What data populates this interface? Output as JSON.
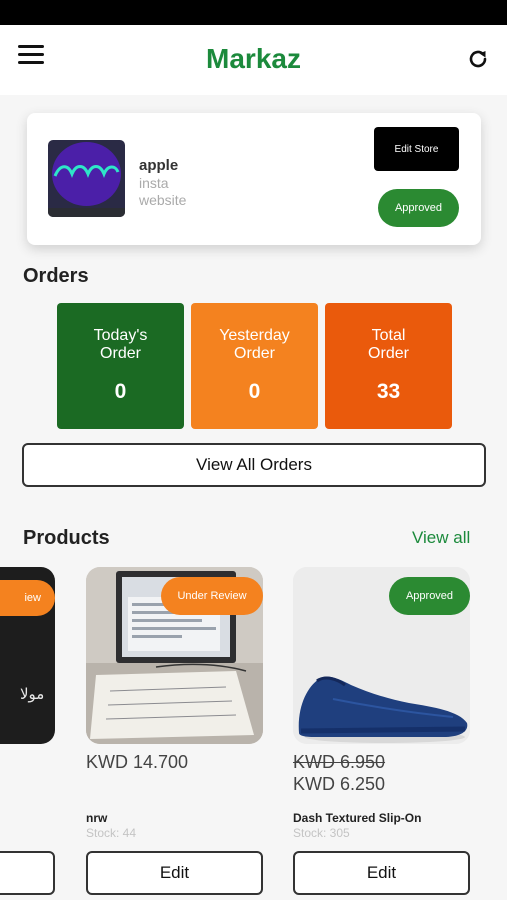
{
  "header": {
    "title": "Markaz",
    "menu_icon": "hamburger-menu-icon",
    "refresh_icon": "refresh-icon"
  },
  "store": {
    "name": "apple",
    "line1": "insta",
    "line2": "website",
    "edit_label": "Edit Store",
    "status": "Approved"
  },
  "orders": {
    "title": "Orders",
    "stats": [
      {
        "label": "Today's\nOrder",
        "value": "0",
        "color": "#1b6a23"
      },
      {
        "label": "Yesterday\nOrder",
        "value": "0",
        "color": "#f4821f"
      },
      {
        "label": "Total\nOrder",
        "value": "33",
        "color": "#ea5a0c"
      }
    ],
    "view_all_label": "View All Orders"
  },
  "products": {
    "title": "Products",
    "view_all_label": "View all",
    "partial": {
      "badge": "iew",
      "image_text": "مولا",
      "edit_label": ""
    },
    "items": [
      {
        "status": "Under Review",
        "price": "KWD 14.700",
        "name": "nrw",
        "stock": "Stock: 44",
        "edit_label": "Edit"
      },
      {
        "status": "Approved",
        "old_price": "KWD 6.950",
        "price": "KWD 6.250",
        "name": "Dash Textured Slip-On",
        "stock": "Stock: 305",
        "edit_label": "Edit"
      }
    ]
  },
  "colors": {
    "brand_green": "#1c8a3c",
    "approved": "#2b8a32",
    "review": "#f4821f"
  }
}
